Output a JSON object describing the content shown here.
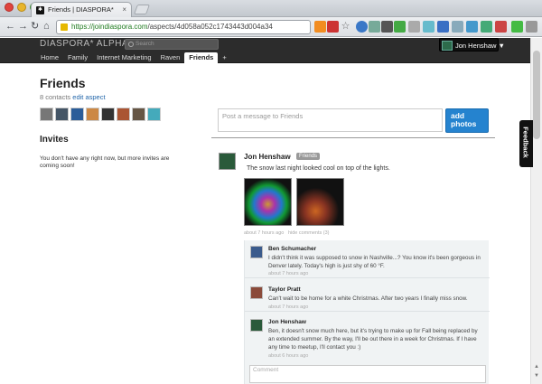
{
  "browser": {
    "tab_title": "Friends | DIASPORA*",
    "tab_favicon": "asterisk-icon",
    "url_scheme": "https://",
    "url_host": "joindiaspora.com",
    "url_path": "/aspects/4d058a052c1743443d004a34"
  },
  "header": {
    "brand": "DIASPORA* ALPHA",
    "search_placeholder": "Search",
    "user_name": "Jon Henshaw ▼",
    "tabs": [
      {
        "label": "Home"
      },
      {
        "label": "Family"
      },
      {
        "label": "Internet Marketing"
      },
      {
        "label": "Raven"
      },
      {
        "label": "Friends",
        "active": true
      },
      {
        "label": "+"
      }
    ]
  },
  "sidebar": {
    "title": "Friends",
    "contacts_count": "8 contacts",
    "edit_link": "edit aspect",
    "invites_title": "Invites",
    "invites_text": "You don't have any right now, but more invites are coming soon!"
  },
  "publisher": {
    "placeholder": "Post a message to Friends",
    "button_label": "add photos"
  },
  "feedback_label": "Feedback",
  "post": {
    "author": "Jon Henshaw",
    "aspect": "Friends",
    "text": "The snow last night looked cool on top of the lights.",
    "time": "about 7 hours ago",
    "comments_link": "hide comments (3)"
  },
  "comments": [
    {
      "author": "Ben Schumacher",
      "text": "I didn't think it was supposed to snow in Nashville...? You know it's been gorgeous in Denver lately. Today's high is just shy of 60 °F.",
      "time": "about 7 hours ago"
    },
    {
      "author": "Taylor Pratt",
      "text": "Can't wait to be home for a white Christmas. After two years I finally miss snow.",
      "time": "about 7 hours ago"
    },
    {
      "author": "Jon Henshaw",
      "text": "Ben, it doesn't snow much here, but it's trying to make up for Fall being replaced by an extended summer. By the way, I'll be out there in a week for Christmas. If I have any time to meetup, I'll contact you :)",
      "time": "about 6 hours ago"
    }
  ],
  "comment_placeholder": "Comment"
}
